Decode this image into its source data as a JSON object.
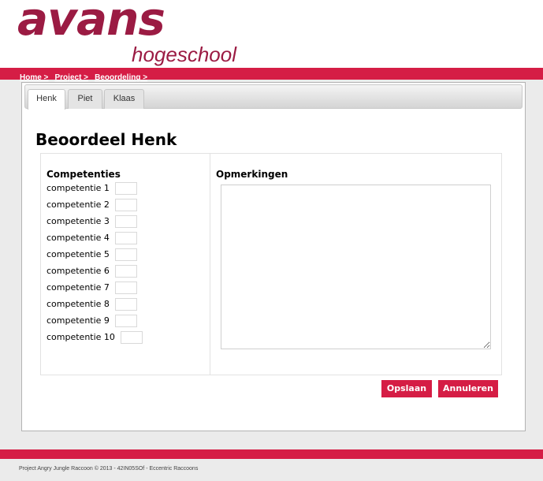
{
  "header": {
    "logo_main": "avans",
    "logo_sub": "hogeschool"
  },
  "breadcrumb": [
    "Home >",
    "Project >",
    "Beoordeling >"
  ],
  "tabs": [
    {
      "label": "Henk",
      "active": true
    },
    {
      "label": "Piet",
      "active": false
    },
    {
      "label": "Klaas",
      "active": false
    }
  ],
  "page_title": "Beoordeel Henk",
  "competencies": {
    "heading": "Competenties",
    "items": [
      {
        "label": "competentie 1",
        "value": ""
      },
      {
        "label": "competentie 2",
        "value": ""
      },
      {
        "label": "competentie 3",
        "value": ""
      },
      {
        "label": "competentie 4",
        "value": ""
      },
      {
        "label": "competentie 5",
        "value": ""
      },
      {
        "label": "competentie 6",
        "value": ""
      },
      {
        "label": "competentie 7",
        "value": ""
      },
      {
        "label": "competentie 8",
        "value": ""
      },
      {
        "label": "competentie 9",
        "value": ""
      },
      {
        "label": "competentie 10",
        "value": ""
      }
    ]
  },
  "remarks": {
    "heading": "Opmerkingen",
    "value": ""
  },
  "buttons": {
    "save": "Opslaan",
    "cancel": "Annuleren"
  },
  "footer": {
    "text": "Project Angry Jungle Raccoon © 2013 - 42IN05SOf - Eccentric Raccoons"
  },
  "colors": {
    "brand_red": "#d51d45",
    "logo_maroon": "#9b1b43"
  }
}
